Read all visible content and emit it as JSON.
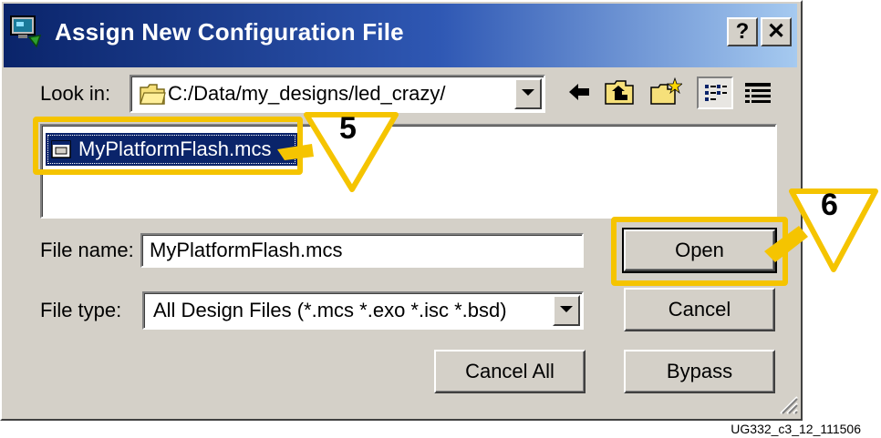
{
  "window": {
    "title": "Assign New Configuration File",
    "help_label": "?",
    "close_label": "✕"
  },
  "look_in": {
    "label": "Look in:",
    "value": "C:/Data/my_designs/led_crazy/"
  },
  "toolbar_icons": [
    "back-arrow-icon",
    "up-folder-icon",
    "new-folder-icon",
    "list-view-icon",
    "details-view-icon"
  ],
  "file_list": {
    "items": [
      {
        "name": "MyPlatformFlash.mcs",
        "selected": true
      }
    ]
  },
  "file_name": {
    "label": "File name:",
    "value": "MyPlatformFlash.mcs"
  },
  "file_type": {
    "label": "File type:",
    "value": "All Design Files (*.mcs *.exo *.isc *.bsd)"
  },
  "buttons": {
    "open": "Open",
    "cancel": "Cancel",
    "cancel_all": "Cancel All",
    "bypass": "Bypass"
  },
  "callouts": [
    {
      "number": "5"
    },
    {
      "number": "6"
    }
  ],
  "figure_id": "UG332_c3_12_111506",
  "colors": {
    "title_bar": "#0a246a",
    "selection": "#0a246a",
    "callout": "#f5c400",
    "dialog_bg": "#d4d0c8"
  }
}
